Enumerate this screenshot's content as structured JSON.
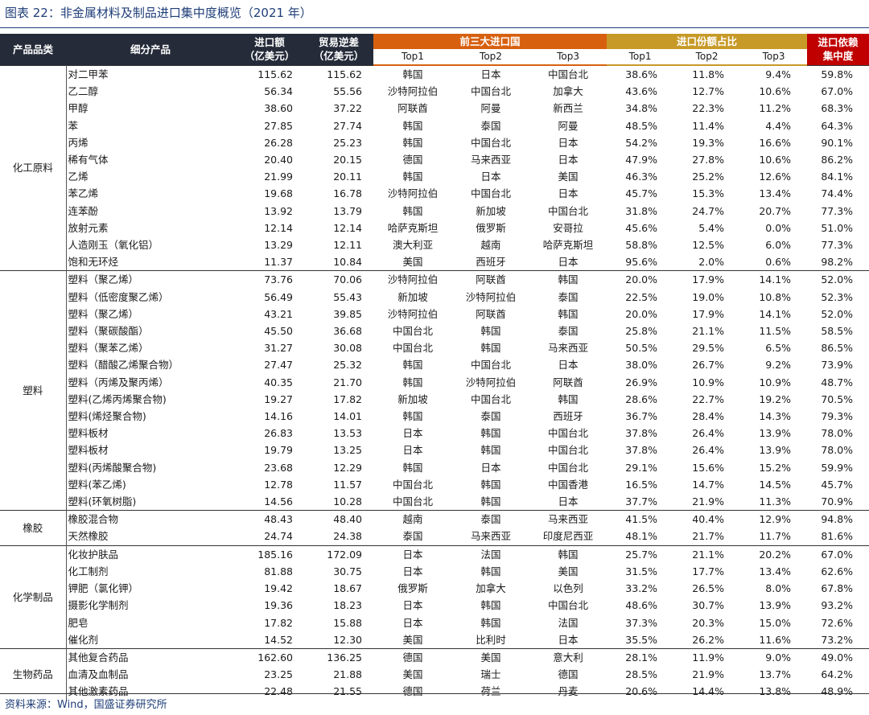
{
  "title": "图表 22：非金属材料及制品进口集中度概览（2021 年）",
  "source": "资料来源：Wind，国盛证券研究所",
  "headers": {
    "category": "产品品类",
    "product": "细分产品",
    "import_amount": "进口额\n（亿美元）",
    "trade_deficit": "贸易逆差\n（亿美元）",
    "top3_countries": "前三大进口国",
    "share": "进口份额占比",
    "dependency": "进口依赖\n集中度",
    "top1": "Top1",
    "top2": "Top2",
    "top3": "Top3"
  },
  "groups": [
    {
      "category": "化工原料",
      "rows": [
        [
          "对二甲苯",
          "115.62",
          "115.62",
          "韩国",
          "日本",
          "中国台北",
          "38.6%",
          "11.8%",
          "9.4%",
          "59.8%"
        ],
        [
          "乙二醇",
          "56.34",
          "55.56",
          "沙特阿拉伯",
          "中国台北",
          "加拿大",
          "43.6%",
          "12.7%",
          "10.6%",
          "67.0%"
        ],
        [
          "甲醇",
          "38.60",
          "37.22",
          "阿联酋",
          "阿曼",
          "新西兰",
          "34.8%",
          "22.3%",
          "11.2%",
          "68.3%"
        ],
        [
          "苯",
          "27.85",
          "27.74",
          "韩国",
          "泰国",
          "阿曼",
          "48.5%",
          "11.4%",
          "4.4%",
          "64.3%"
        ],
        [
          "丙烯",
          "26.28",
          "25.23",
          "韩国",
          "中国台北",
          "日本",
          "54.2%",
          "19.3%",
          "16.6%",
          "90.1%"
        ],
        [
          "稀有气体",
          "20.40",
          "20.15",
          "德国",
          "马来西亚",
          "日本",
          "47.9%",
          "27.8%",
          "10.6%",
          "86.2%"
        ],
        [
          "乙烯",
          "21.99",
          "20.11",
          "韩国",
          "日本",
          "美国",
          "46.3%",
          "25.2%",
          "12.6%",
          "84.1%"
        ],
        [
          "苯乙烯",
          "19.68",
          "16.78",
          "沙特阿拉伯",
          "中国台北",
          "日本",
          "45.7%",
          "15.3%",
          "13.4%",
          "74.4%"
        ],
        [
          "连苯酚",
          "13.92",
          "13.79",
          "韩国",
          "新加坡",
          "中国台北",
          "31.8%",
          "24.7%",
          "20.7%",
          "77.3%"
        ],
        [
          "放射元素",
          "12.14",
          "12.14",
          "哈萨克斯坦",
          "俄罗斯",
          "安哥拉",
          "45.6%",
          "5.4%",
          "0.0%",
          "51.0%"
        ],
        [
          "人造刚玉（氧化铝）",
          "13.29",
          "12.11",
          "澳大利亚",
          "越南",
          "哈萨克斯坦",
          "58.8%",
          "12.5%",
          "6.0%",
          "77.3%"
        ],
        [
          "饱和无环烃",
          "11.37",
          "10.84",
          "美国",
          "西班牙",
          "日本",
          "95.6%",
          "2.0%",
          "0.6%",
          "98.2%"
        ]
      ]
    },
    {
      "category": "塑料",
      "rows": [
        [
          "塑料（聚乙烯）",
          "73.76",
          "70.06",
          "沙特阿拉伯",
          "阿联酋",
          "韩国",
          "20.0%",
          "17.9%",
          "14.1%",
          "52.0%"
        ],
        [
          "塑料（低密度聚乙烯）",
          "56.49",
          "55.43",
          "新加坡",
          "沙特阿拉伯",
          "泰国",
          "22.5%",
          "19.0%",
          "10.8%",
          "52.3%"
        ],
        [
          "塑料（聚乙烯）",
          "43.21",
          "39.85",
          "沙特阿拉伯",
          "阿联酋",
          "韩国",
          "20.0%",
          "17.9%",
          "14.1%",
          "52.0%"
        ],
        [
          "塑料（聚碳酸酯）",
          "45.50",
          "36.68",
          "中国台北",
          "韩国",
          "泰国",
          "25.8%",
          "21.1%",
          "11.5%",
          "58.5%"
        ],
        [
          "塑料（聚苯乙烯）",
          "31.27",
          "30.08",
          "中国台北",
          "韩国",
          "马来西亚",
          "50.5%",
          "29.5%",
          "6.5%",
          "86.5%"
        ],
        [
          "塑料（醋酸乙烯聚合物）",
          "27.47",
          "25.32",
          "韩国",
          "中国台北",
          "日本",
          "38.0%",
          "26.7%",
          "9.2%",
          "73.9%"
        ],
        [
          "塑料（丙烯及聚丙烯）",
          "40.35",
          "21.70",
          "韩国",
          "沙特阿拉伯",
          "阿联酋",
          "26.9%",
          "10.9%",
          "10.9%",
          "48.7%"
        ],
        [
          "塑料(乙烯丙烯聚合物)",
          "19.27",
          "17.82",
          "新加坡",
          "中国台北",
          "韩国",
          "28.6%",
          "22.7%",
          "19.2%",
          "70.5%"
        ],
        [
          "塑料(烯烃聚合物)",
          "14.16",
          "14.01",
          "韩国",
          "泰国",
          "西班牙",
          "36.7%",
          "28.4%",
          "14.3%",
          "79.3%"
        ],
        [
          "塑料板材",
          "26.83",
          "13.53",
          "日本",
          "韩国",
          "中国台北",
          "37.8%",
          "26.4%",
          "13.9%",
          "78.0%"
        ],
        [
          "塑料板材",
          "19.79",
          "13.25",
          "日本",
          "韩国",
          "中国台北",
          "37.8%",
          "26.4%",
          "13.9%",
          "78.0%"
        ],
        [
          "塑料(丙烯酸聚合物)",
          "23.68",
          "12.29",
          "韩国",
          "日本",
          "中国台北",
          "29.1%",
          "15.6%",
          "15.2%",
          "59.9%"
        ],
        [
          "塑料(苯乙烯)",
          "12.78",
          "11.57",
          "中国台北",
          "韩国",
          "中国香港",
          "16.5%",
          "14.7%",
          "14.5%",
          "45.7%"
        ],
        [
          "塑料(环氧树脂)",
          "14.56",
          "10.28",
          "中国台北",
          "韩国",
          "日本",
          "37.7%",
          "21.9%",
          "11.3%",
          "70.9%"
        ]
      ]
    },
    {
      "category": "橡胶",
      "rows": [
        [
          "橡胶混合物",
          "48.43",
          "48.40",
          "越南",
          "泰国",
          "马来西亚",
          "41.5%",
          "40.4%",
          "12.9%",
          "94.8%"
        ],
        [
          "天然橡胶",
          "24.74",
          "24.38",
          "泰国",
          "马来西亚",
          "印度尼西亚",
          "48.1%",
          "21.7%",
          "11.7%",
          "81.6%"
        ]
      ]
    },
    {
      "category": "化学制品",
      "rows": [
        [
          "化妆护肤品",
          "185.16",
          "172.09",
          "日本",
          "法国",
          "韩国",
          "25.7%",
          "21.1%",
          "20.2%",
          "67.0%"
        ],
        [
          "化工制剂",
          "81.88",
          "30.75",
          "日本",
          "韩国",
          "美国",
          "31.5%",
          "17.7%",
          "13.4%",
          "62.6%"
        ],
        [
          "钾肥（氯化钾）",
          "19.42",
          "18.67",
          "俄罗斯",
          "加拿大",
          "以色列",
          "33.2%",
          "26.5%",
          "8.0%",
          "67.8%"
        ],
        [
          "摄影化学制剂",
          "19.36",
          "18.23",
          "日本",
          "韩国",
          "中国台北",
          "48.6%",
          "30.7%",
          "13.9%",
          "93.2%"
        ],
        [
          "肥皂",
          "17.82",
          "15.88",
          "日本",
          "韩国",
          "法国",
          "37.3%",
          "20.3%",
          "15.0%",
          "72.6%"
        ],
        [
          "催化剂",
          "14.52",
          "12.30",
          "美国",
          "比利时",
          "日本",
          "35.5%",
          "26.2%",
          "11.6%",
          "73.2%"
        ]
      ]
    },
    {
      "category": "生物药品",
      "rows": [
        [
          "其他复合药品",
          "162.60",
          "136.25",
          "德国",
          "美国",
          "意大利",
          "28.1%",
          "11.9%",
          "9.0%",
          "49.0%"
        ],
        [
          "血清及血制品",
          "23.25",
          "21.88",
          "美国",
          "瑞士",
          "德国",
          "28.5%",
          "21.9%",
          "13.7%",
          "64.2%"
        ],
        [
          "其他激素药品",
          "22.48",
          "21.55",
          "德国",
          "荷兰",
          "丹麦",
          "20.6%",
          "14.4%",
          "13.8%",
          "48.9%"
        ]
      ]
    }
  ]
}
